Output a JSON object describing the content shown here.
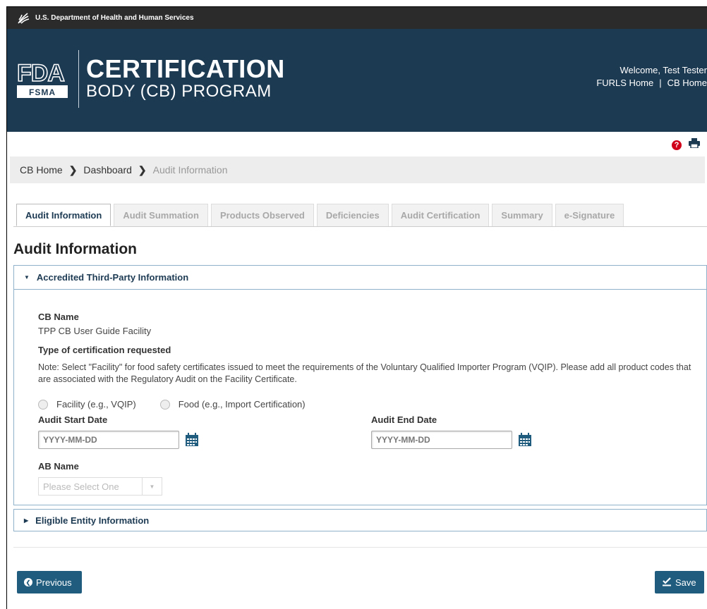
{
  "hhs": {
    "text": "U.S. Department of Health and Human Services",
    "icon": "hhs-eagle-icon"
  },
  "banner": {
    "logo_text_top": "FDA",
    "logo_text_bottom": "FSMA",
    "title_line1": "CERTIFICATION",
    "title_line2": "BODY (CB) PROGRAM",
    "welcome": "Welcome, Test Tester",
    "link_furls": "FURLS Home",
    "link_separator": "|",
    "link_cb": "CB Home",
    "bg_color": "#1d3a53"
  },
  "toolbar": {
    "help_icon": "question-circle-icon",
    "help_glyph": "?",
    "print_icon": "print-icon"
  },
  "breadcrumb": {
    "items": [
      "CB Home",
      "Dashboard",
      "Audit Information"
    ],
    "separator": "❯"
  },
  "tabs": [
    {
      "label": "Audit Information",
      "active": true
    },
    {
      "label": "Audit Summation",
      "active": false
    },
    {
      "label": "Products Observed",
      "active": false
    },
    {
      "label": "Deficiencies",
      "active": false
    },
    {
      "label": "Audit Certification",
      "active": false
    },
    {
      "label": "Summary",
      "active": false
    },
    {
      "label": "e-Signature",
      "active": false
    }
  ],
  "page_title": "Audit Information",
  "panel1": {
    "caret": "▼",
    "title": "Accredited Third-Party Information",
    "cb_name_label": "CB Name",
    "cb_name_value": "TPP CB User Guide Facility",
    "cert_type_label": "Type of certification requested",
    "note": "Note: Select \"Facility\" for food safety certificates issued to meet the requirements of the Voluntary Qualified Importer Program (VQIP). Please add all product codes that are associated with the Regulatory Audit on the Facility Certificate.",
    "radio_facility": "Facility (e.g., VQIP)",
    "radio_food": "Food (e.g., Import Certification)",
    "start_date_label": "Audit Start Date",
    "start_date_placeholder": "YYYY-MM-DD",
    "start_date_value": "",
    "end_date_label": "Audit End Date",
    "end_date_placeholder": "YYYY-MM-DD",
    "end_date_value": "",
    "ab_name_label": "AB Name",
    "ab_name_selected": "Please Select One",
    "select_arrow": "▼",
    "calendar_icon": "calendar-icon"
  },
  "panel2": {
    "caret": "▶",
    "title": "Eligible Entity Information"
  },
  "buttons": {
    "previous": "Previous",
    "previous_icon": "chevron-left-circle-icon",
    "previous_glyph": "❮",
    "save": "Save",
    "save_icon": "check-underline-icon"
  },
  "colors": {
    "accent": "#205c7e",
    "help": "#d0021b",
    "panel_border": "#8fb1c9"
  }
}
